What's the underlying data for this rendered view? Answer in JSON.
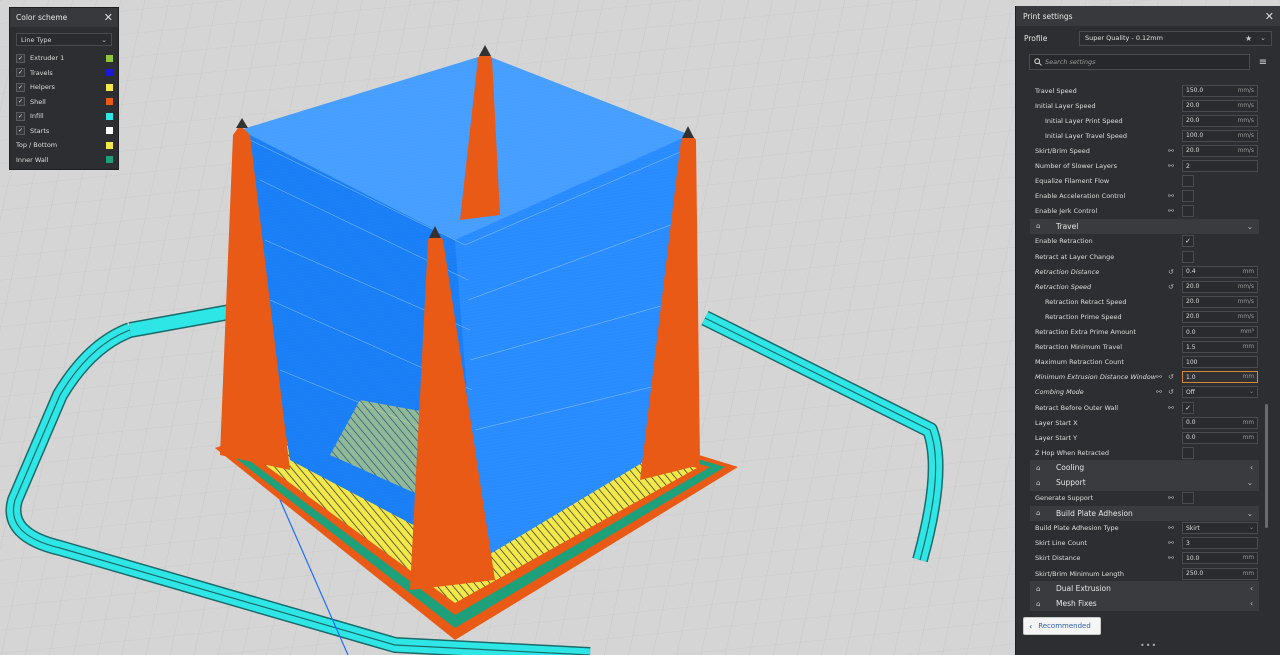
{
  "colors": {
    "panel_bg": "#2d2e31",
    "infill_blue": "#1f86ff",
    "shell_orange": "#e85a16",
    "skirt_cyan": "#2ee6e6",
    "top_yellow": "#f2e84a",
    "inner_wall_teal": "#1ea07a",
    "highlight_orange": "#d28a36"
  },
  "color_scheme": {
    "title": "Color scheme",
    "close_icon": "close-icon",
    "dropdown_value": "Line Type",
    "items": [
      {
        "label": "Extruder 1",
        "checked": true,
        "swatch": "#8fc43b"
      },
      {
        "label": "Travels",
        "checked": true,
        "swatch": "#1a1ad8"
      },
      {
        "label": "Helpers",
        "checked": true,
        "swatch": "#f2e84a"
      },
      {
        "label": "Shell",
        "checked": true,
        "swatch": "#e85a16"
      },
      {
        "label": "Infill",
        "checked": true,
        "swatch": "#2ee6e6"
      },
      {
        "label": "Starts",
        "checked": true,
        "swatch": "#ffffff"
      },
      {
        "label": "Top / Bottom",
        "checked": false,
        "swatch": "#f2e84a"
      },
      {
        "label": "Inner Wall",
        "checked": false,
        "swatch": "#1ea07a"
      }
    ]
  },
  "print_settings": {
    "title": "Print settings",
    "profile_label": "Profile",
    "profile_value": "Super Quality - 0.12mm",
    "search_placeholder": "Search settings",
    "settings": [
      {
        "type": "setting",
        "label": "Travel Speed",
        "value": "150.0",
        "unit": "mm/s"
      },
      {
        "type": "setting",
        "label": "Initial Layer Speed",
        "value": "20.0",
        "unit": "mm/s"
      },
      {
        "type": "setting",
        "label": "Initial Layer Print Speed",
        "value": "20.0",
        "unit": "mm/s",
        "indent": true
      },
      {
        "type": "setting",
        "label": "Initial Layer Travel Speed",
        "value": "100.0",
        "unit": "mm/s",
        "indent": true
      },
      {
        "type": "setting",
        "label": "Skirt/Brim Speed",
        "value": "20.0",
        "unit": "mm/s",
        "link": true
      },
      {
        "type": "setting",
        "label": "Number of Slower Layers",
        "value": "2",
        "unit": "",
        "link": true
      },
      {
        "type": "checkbox",
        "label": "Equalize Filament Flow",
        "checked": false
      },
      {
        "type": "checkbox",
        "label": "Enable Acceleration Control",
        "checked": false,
        "link": true
      },
      {
        "type": "checkbox",
        "label": "Enable Jerk Control",
        "checked": false,
        "link": true
      },
      {
        "type": "category",
        "label": "Travel",
        "icon": "travel-icon",
        "chevron": "⌄"
      },
      {
        "type": "checkbox",
        "label": "Enable Retraction",
        "checked": true
      },
      {
        "type": "checkbox",
        "label": "Retract at Layer Change",
        "checked": false
      },
      {
        "type": "setting",
        "label": "Retraction Distance",
        "value": "0.4",
        "unit": "mm",
        "italic": true,
        "reset": true
      },
      {
        "type": "setting",
        "label": "Retraction Speed",
        "value": "20.0",
        "unit": "mm/s",
        "italic": true,
        "reset": true
      },
      {
        "type": "setting",
        "label": "Retraction Retract Speed",
        "value": "20.0",
        "unit": "mm/s",
        "indent": true
      },
      {
        "type": "setting",
        "label": "Retraction Prime Speed",
        "value": "20.0",
        "unit": "mm/s",
        "indent": true
      },
      {
        "type": "setting",
        "label": "Retraction Extra Prime Amount",
        "value": "0.0",
        "unit": "mm³"
      },
      {
        "type": "setting",
        "label": "Retraction Minimum Travel",
        "value": "1.5",
        "unit": "mm"
      },
      {
        "type": "setting",
        "label": "Maximum Retraction Count",
        "value": "100",
        "unit": ""
      },
      {
        "type": "setting",
        "label": "Minimum Extrusion Distance Window",
        "value": "1.0",
        "unit": "mm",
        "italic": true,
        "reset": true,
        "link": true,
        "highlight": true
      },
      {
        "type": "select",
        "label": "Combing Mode",
        "value": "Off",
        "italic": true,
        "reset": true,
        "link": true
      },
      {
        "type": "checkbox",
        "label": "Retract Before Outer Wall",
        "checked": true,
        "link": true
      },
      {
        "type": "setting",
        "label": "Layer Start X",
        "value": "0.0",
        "unit": "mm"
      },
      {
        "type": "setting",
        "label": "Layer Start Y",
        "value": "0.0",
        "unit": "mm"
      },
      {
        "type": "checkbox",
        "label": "Z Hop When Retracted",
        "checked": false
      },
      {
        "type": "category",
        "label": "Cooling",
        "icon": "cooling-fan-icon",
        "chevron": "‹"
      },
      {
        "type": "category",
        "label": "Support",
        "icon": "support-icon",
        "chevron": "⌄"
      },
      {
        "type": "checkbox",
        "label": "Generate Support",
        "checked": false,
        "link": true
      },
      {
        "type": "category",
        "label": "Build Plate Adhesion",
        "icon": "adhesion-icon",
        "chevron": "⌄"
      },
      {
        "type": "select",
        "label": "Build Plate Adhesion Type",
        "value": "Skirt",
        "link": true
      },
      {
        "type": "setting",
        "label": "Skirt Line Count",
        "value": "3",
        "unit": "",
        "link": true
      },
      {
        "type": "setting",
        "label": "Skirt Distance",
        "value": "10.0",
        "unit": "mm",
        "link": true
      },
      {
        "type": "setting",
        "label": "Skirt/Brim Minimum Length",
        "value": "250.0",
        "unit": "mm"
      },
      {
        "type": "category",
        "label": "Dual Extrusion",
        "icon": "dual-extrusion-icon",
        "chevron": "‹"
      },
      {
        "type": "category",
        "label": "Mesh Fixes",
        "icon": "mesh-fixes-icon",
        "chevron": "‹"
      }
    ],
    "recommended_label": "Recommended"
  }
}
